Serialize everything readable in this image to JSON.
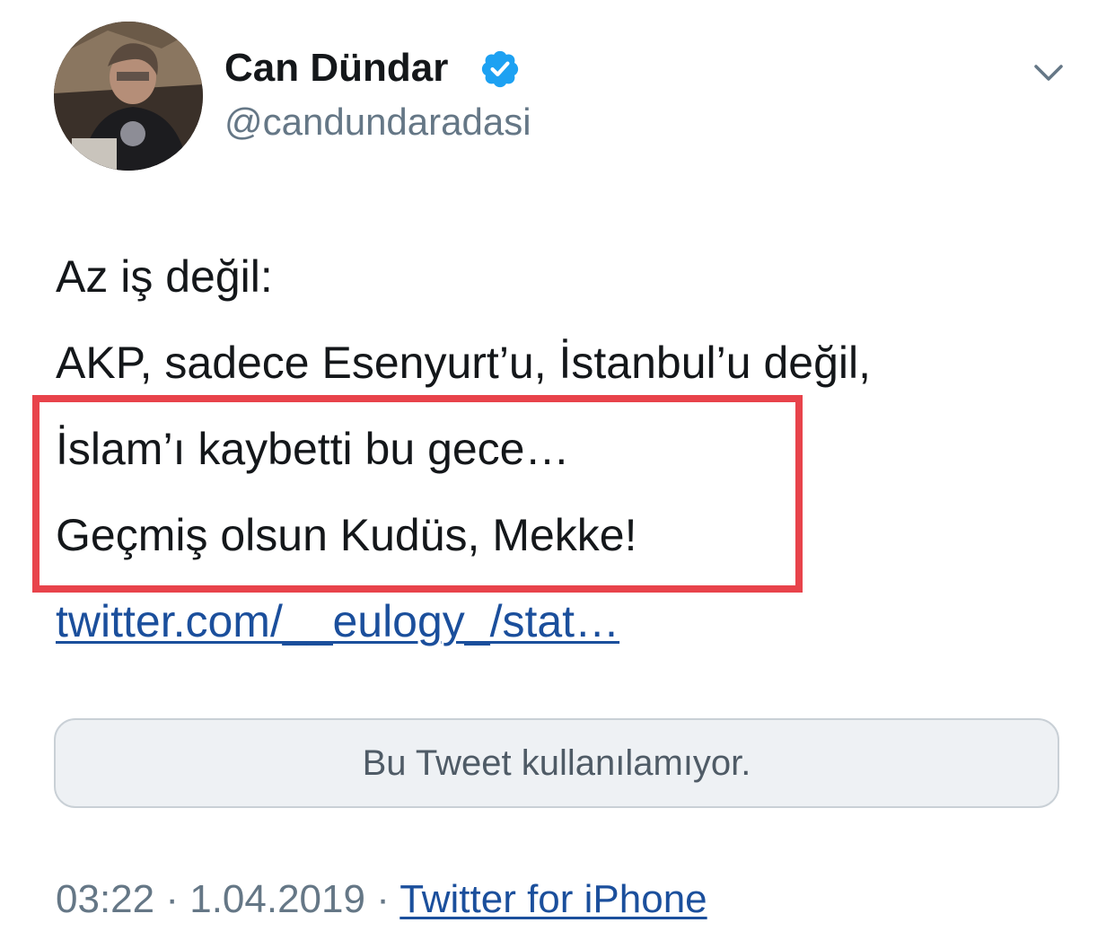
{
  "author": {
    "display_name": "Can Dündar",
    "handle": "@candundaradasi",
    "verified": true,
    "avatar_icon": "profile-photo"
  },
  "menu": {
    "icon": "chevron-down-icon"
  },
  "tweet": {
    "lines": [
      "Az iş değil:",
      "AKP, sadece Esenyurt’u, İstanbul’u değil,",
      "İslam’ı kaybetti bu gece…",
      "Geçmiş olsun Kudüs, Mekke!"
    ],
    "link": "twitter.com/__eulogy_/stat…",
    "highlight_color": "#e8434b"
  },
  "quoted_card": {
    "text": "Bu Tweet kullanılamıyor."
  },
  "meta": {
    "time": "03:22",
    "separator": " · ",
    "date": "1.04.2019",
    "source": "Twitter for iPhone"
  },
  "colors": {
    "text": "#14171a",
    "secondary": "#657786",
    "link": "#1b4f9c",
    "verified": "#1da1f2"
  }
}
